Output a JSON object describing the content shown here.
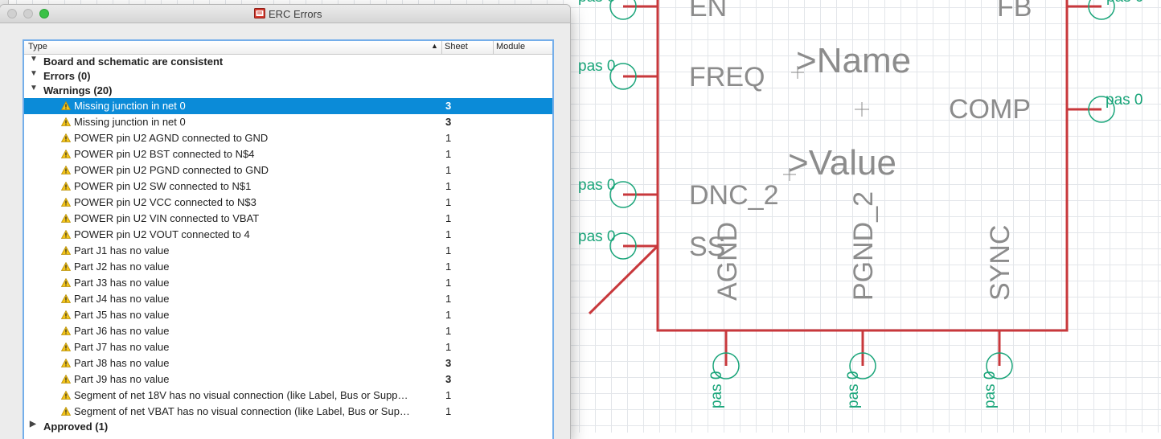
{
  "window": {
    "title": "ERC Errors"
  },
  "columns": {
    "type": "Type",
    "sheet": "Sheet",
    "module": "Module"
  },
  "groups": {
    "consistent": "Board and schematic are consistent",
    "errors": "Errors (0)",
    "warnings": "Warnings (20)",
    "approved": "Approved (1)"
  },
  "warnings": [
    {
      "text": "Missing junction in net 0",
      "sheet": "3",
      "selected": true
    },
    {
      "text": "Missing junction in net 0",
      "sheet": "3"
    },
    {
      "text": "POWER pin U2 AGND connected to GND",
      "sheet": "1"
    },
    {
      "text": "POWER pin U2 BST connected to N$4",
      "sheet": "1"
    },
    {
      "text": "POWER pin U2 PGND connected to GND",
      "sheet": "1"
    },
    {
      "text": "POWER pin U2 SW connected to N$1",
      "sheet": "1"
    },
    {
      "text": "POWER pin U2 VCC connected to N$3",
      "sheet": "1"
    },
    {
      "text": "POWER pin U2 VIN connected to VBAT",
      "sheet": "1"
    },
    {
      "text": "POWER pin U2 VOUT connected to 4",
      "sheet": "1"
    },
    {
      "text": "Part J1 has no value",
      "sheet": "1"
    },
    {
      "text": "Part J2 has no value",
      "sheet": "1"
    },
    {
      "text": "Part J3 has no value",
      "sheet": "1"
    },
    {
      "text": "Part J4 has no value",
      "sheet": "1"
    },
    {
      "text": "Part J5 has no value",
      "sheet": "1"
    },
    {
      "text": "Part J6 has no value",
      "sheet": "1"
    },
    {
      "text": "Part J7 has no value",
      "sheet": "1"
    },
    {
      "text": "Part J8 has no value",
      "sheet": "3"
    },
    {
      "text": "Part J9 has no value",
      "sheet": "3"
    },
    {
      "text": "Segment of net 18V has no visual connection (like Label, Bus or Supp…",
      "sheet": "1"
    },
    {
      "text": "Segment of net VBAT has no visual connection (like Label, Bus or Sup…",
      "sheet": "1"
    }
  ],
  "schematic": {
    "name_placeholder": ">Name",
    "value_placeholder": ">Value",
    "pins": {
      "en": "EN",
      "fb": "FB",
      "freq": "FREQ",
      "comp": "COMP",
      "dnc2": "DNC_2",
      "ss": "SS",
      "agnd": "AGND",
      "pgnd2": "PGND_2",
      "sync": "SYNC"
    },
    "pas_label": "pas 0",
    "colors": {
      "body": "#c8383c",
      "pin_text": "#8c8c8c",
      "pas": "#1aa57a",
      "selection": "#0b8bd8"
    }
  }
}
